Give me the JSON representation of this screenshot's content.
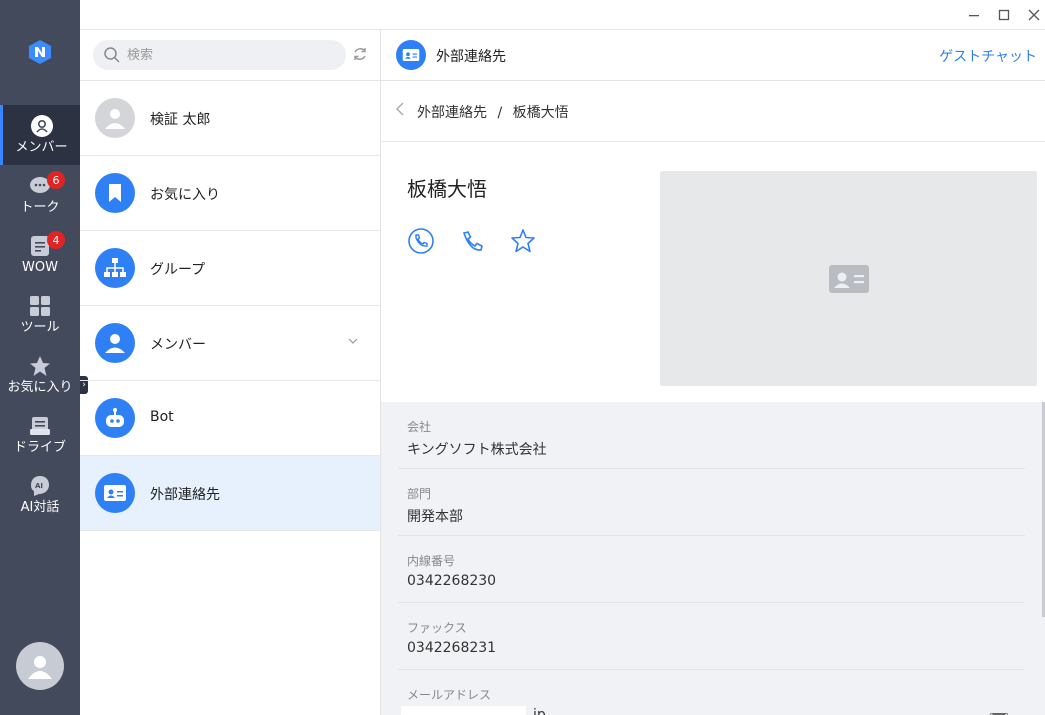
{
  "rail": {
    "items": [
      {
        "label": "メンバー",
        "icon": "person-icon"
      },
      {
        "label": "トーク",
        "icon": "chat-icon",
        "badge": "6"
      },
      {
        "label": "WOW",
        "icon": "wow-icon",
        "badge": "4"
      },
      {
        "label": "ツール",
        "icon": "grid-icon"
      },
      {
        "label": "お気に入り",
        "icon": "star-icon"
      },
      {
        "label": "ドライブ",
        "icon": "drive-icon"
      },
      {
        "label": "AI対話",
        "icon": "ai-icon"
      }
    ]
  },
  "search": {
    "placeholder": "検索"
  },
  "list": [
    {
      "label": "検証 太郎"
    },
    {
      "label": "お気に入り"
    },
    {
      "label": "グループ"
    },
    {
      "label": "メンバー"
    },
    {
      "label": "Bot"
    },
    {
      "label": "外部連絡先"
    }
  ],
  "header": {
    "title": "外部連絡先",
    "link": "ゲストチャット"
  },
  "breadcrumb": {
    "parent": "外部連絡先",
    "sep": "/",
    "current": "板橋大悟"
  },
  "profile": {
    "name": "板橋大悟"
  },
  "fields": [
    {
      "label": "会社",
      "value": "キングソフト株式会社"
    },
    {
      "label": "部門",
      "value": "開発本部"
    },
    {
      "label": "内線番号",
      "value": "0342268230"
    },
    {
      "label": "ファックス",
      "value": "0342268231"
    },
    {
      "label": "メールアドレス",
      "value": "jp"
    }
  ],
  "colors": {
    "accent": "#2f7ff5",
    "rail": "#434a5c",
    "badge": "#e02424"
  }
}
